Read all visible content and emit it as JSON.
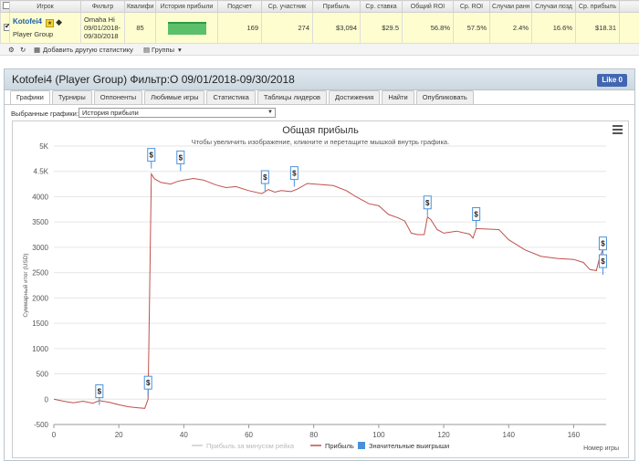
{
  "table": {
    "headers": [
      "Игрок",
      "Фильтр",
      "Квалифи",
      "История прибыли",
      "Подсчет",
      "Ср. участник",
      "Прибыль",
      "Ср. ставка",
      "Общий ROI",
      "Ср. ROI",
      "Случаи ранн",
      "Случаи позд",
      "Ср. прибыль"
    ],
    "row": {
      "player_name": "Kotofei4",
      "player_group": "Player Group",
      "filter_line1": "Omaha Hi",
      "filter_line2": "09/01/2018-",
      "filter_line3": "09/30/2018",
      "qualifier": "85",
      "count": "169",
      "avg_entrants": "274",
      "profit": "$3,094",
      "avg_stake": "$29.5",
      "total_roi": "56.8%",
      "avg_roi": "57.5%",
      "early_cases": "2.4%",
      "late_cases": "16.6%",
      "avg_profit": "$18.31"
    }
  },
  "toolbar": {
    "add_stats": "Добавить другую статистику",
    "groups": "Группы"
  },
  "panel": {
    "title": "Kotofei4 (Player Group) Фильтр:O 09/01/2018-09/30/2018",
    "like_label": "Like 0",
    "tabs": [
      "Графики",
      "Турниры",
      "Оппоненты",
      "Любимые игры",
      "Статистика",
      "Таблицы лидеров",
      "Достижения",
      "Найти",
      "Опубликовать"
    ],
    "select_label": "Выбранные графики:",
    "select_value": "История прибыли"
  },
  "colors": {
    "line": "#c0504d",
    "accent": "#1a5ea8",
    "marker": "#4a90d9"
  },
  "chart_data": {
    "type": "line",
    "title": "Общая прибыль",
    "subtitle": "Чтобы увеличить изображение, кликните и перетащите мышкой внутрь графика.",
    "ylabel": "Суммарный итог (USD)",
    "xlabel": "Номер игры",
    "xlim": [
      0,
      170
    ],
    "ylim": [
      -500,
      5000
    ],
    "x_ticks": [
      0,
      20,
      40,
      60,
      80,
      100,
      120,
      140,
      160
    ],
    "y_ticks": [
      -500,
      0,
      500,
      1000,
      1500,
      2000,
      2500,
      3000,
      3500,
      4000,
      4500,
      5000
    ],
    "y_tick_labels": [
      "-500",
      "0",
      "500",
      "1000",
      "1500",
      "2000",
      "2500",
      "3000",
      "3500",
      "4000",
      "4.5K",
      "5K"
    ],
    "grid": true,
    "legend_position": "bottom",
    "series": [
      {
        "name": "Прибыль за минусом рейка",
        "values": []
      },
      {
        "name": "Прибыль",
        "x": [
          0,
          3,
          6,
          9,
          12,
          14,
          17,
          20,
          23,
          26,
          28,
          29,
          30,
          31,
          33,
          36,
          38,
          40,
          43,
          46,
          50,
          53,
          56,
          60,
          64,
          66,
          68,
          70,
          73,
          75,
          78,
          82,
          86,
          90,
          93,
          97,
          100,
          103,
          106,
          108,
          110,
          112,
          114,
          115,
          116,
          118,
          120,
          124,
          128,
          129,
          130,
          133,
          137,
          140,
          145,
          150,
          155,
          160,
          163,
          165,
          167,
          168,
          169
        ],
        "y": [
          0,
          -40,
          -70,
          -40,
          -80,
          -30,
          -60,
          -110,
          -150,
          -170,
          -180,
          0,
          4450,
          4350,
          4280,
          4250,
          4300,
          4330,
          4360,
          4330,
          4230,
          4180,
          4200,
          4120,
          4060,
          4140,
          4090,
          4120,
          4100,
          4150,
          4260,
          4240,
          4220,
          4120,
          4000,
          3860,
          3820,
          3650,
          3580,
          3520,
          3280,
          3250,
          3250,
          3600,
          3550,
          3350,
          3280,
          3320,
          3260,
          3180,
          3370,
          3360,
          3350,
          3150,
          2950,
          2820,
          2780,
          2760,
          2700,
          2560,
          2540,
          2800,
          2950
        ]
      }
    ],
    "significant_wins_label": "Значительные выигрыши",
    "significant_wins": [
      {
        "x": 14,
        "y": 30,
        "label": "$"
      },
      {
        "x": 29,
        "y": 200,
        "label": "$"
      },
      {
        "x": 30,
        "y": 4700,
        "label": "$"
      },
      {
        "x": 39,
        "y": 4650,
        "label": "$"
      },
      {
        "x": 65,
        "y": 4260,
        "label": "$"
      },
      {
        "x": 74,
        "y": 4340,
        "label": "$"
      },
      {
        "x": 115,
        "y": 3760,
        "label": "$"
      },
      {
        "x": 130,
        "y": 3530,
        "label": "$"
      },
      {
        "x": 169,
        "y": 2950,
        "label": "$"
      },
      {
        "x": 169,
        "y": 2600,
        "label": "$"
      }
    ]
  }
}
